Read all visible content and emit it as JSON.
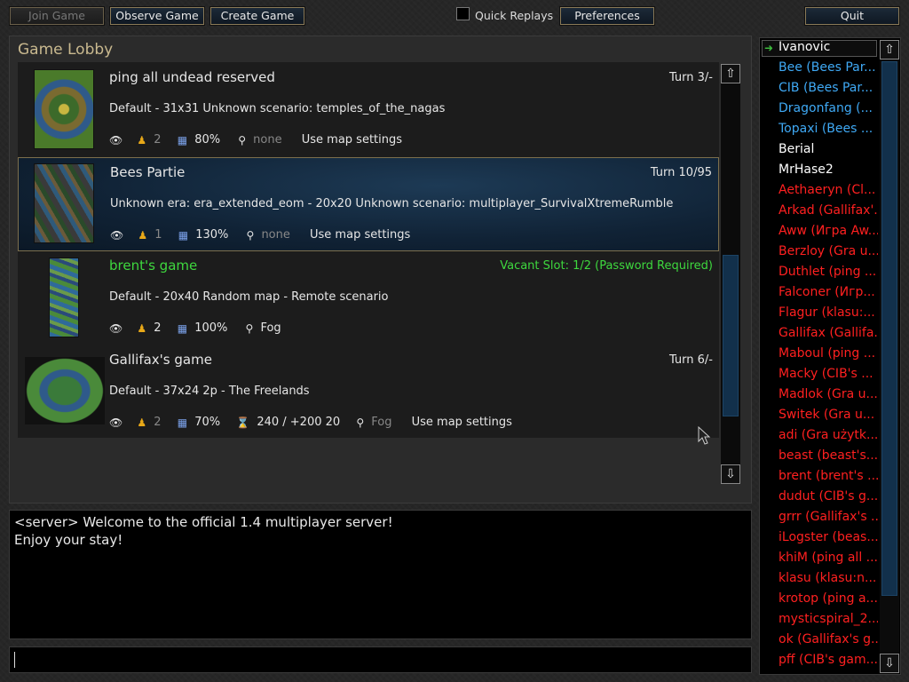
{
  "toolbar": {
    "join_game": "Join Game",
    "observe_game": "Observe Game",
    "create_game": "Create Game",
    "quick_replays": "Quick Replays",
    "preferences": "Preferences",
    "quit": "Quit"
  },
  "lobby": {
    "title": "Game Lobby",
    "games": [
      {
        "name": "ping all undead reserved",
        "status": "Turn 3/-",
        "description": "Default - 31x31 Unknown scenario: temples_of_the_nagas",
        "players": "2",
        "gold": "80%",
        "vision": "none",
        "settings": "Use map settings"
      },
      {
        "name": "Bees Partie",
        "status": "Turn 10/95",
        "description": "Unknown era: era_extended_eom - 20x20 Unknown scenario: multiplayer_SurvivalXtremeRumble",
        "players": "1",
        "gold": "130%",
        "vision": "none",
        "settings": "Use map settings"
      },
      {
        "name": "brent's game",
        "status": "Vacant Slot: 1/2 (Password Required)",
        "description": "Default - 20x40 Random map - Remote scenario",
        "players": "2",
        "gold": "100%",
        "vision": "Fog"
      },
      {
        "name": "Gallifax's game",
        "status": "Turn 6/-",
        "description": "Default - 37x24 2p - The Freelands",
        "players": "2",
        "gold": "70%",
        "timer": "240 / +200 20",
        "vision": "Fog",
        "settings": "Use map settings"
      }
    ]
  },
  "chat": {
    "lines": [
      "<server> Welcome to the official 1.4 multiplayer server!",
      "Enjoy your stay!"
    ],
    "input_value": ""
  },
  "users": [
    {
      "name": "Ivanovic",
      "color": "#ffffff"
    },
    {
      "name": "Bee (Bees Par...",
      "color": "#3fa9f5"
    },
    {
      "name": "CIB (Bees Par...",
      "color": "#3fa9f5"
    },
    {
      "name": "Dragonfang (...",
      "color": "#3fa9f5"
    },
    {
      "name": "Topaxi (Bees ...",
      "color": "#3fa9f5"
    },
    {
      "name": "Berial",
      "color": "#ffffff"
    },
    {
      "name": "MrHase2",
      "color": "#ffffff"
    },
    {
      "name": "Aethaeryn (Cl...",
      "color": "#ff2020"
    },
    {
      "name": "Arkad (Gallifax'...",
      "color": "#ff2020"
    },
    {
      "name": "Aww (Игра Aw...",
      "color": "#ff2020"
    },
    {
      "name": "Berzloy (Gra u...",
      "color": "#ff2020"
    },
    {
      "name": "Duthlet (ping ...",
      "color": "#ff2020"
    },
    {
      "name": "Falconer (Игр...",
      "color": "#ff2020"
    },
    {
      "name": "Flagur (klasu:...",
      "color": "#ff2020"
    },
    {
      "name": "Gallifax (Gallifa...",
      "color": "#ff2020"
    },
    {
      "name": "Maboul (ping ...",
      "color": "#ff2020"
    },
    {
      "name": "Macky (CIB's ...",
      "color": "#ff2020"
    },
    {
      "name": "Madlok (Gra u...",
      "color": "#ff2020"
    },
    {
      "name": "Switek (Gra u...",
      "color": "#ff2020"
    },
    {
      "name": "adi (Gra użytk...",
      "color": "#ff2020"
    },
    {
      "name": "beast (beast's...",
      "color": "#ff2020"
    },
    {
      "name": "brent (brent's ...",
      "color": "#ff2020"
    },
    {
      "name": "dudut (CIB's g...",
      "color": "#ff2020"
    },
    {
      "name": "grrr (Gallifax's ...",
      "color": "#ff2020"
    },
    {
      "name": "iLogster (beas...",
      "color": "#ff2020"
    },
    {
      "name": "khiM (ping all ...",
      "color": "#ff2020"
    },
    {
      "name": "klasu (klasu:n...",
      "color": "#ff2020"
    },
    {
      "name": "krotop (ping a...",
      "color": "#ff2020"
    },
    {
      "name": "mysticspiral_2...",
      "color": "#ff2020"
    },
    {
      "name": "ok (Gallifax's g...",
      "color": "#ff2020"
    },
    {
      "name": "pff (CIB's gam...",
      "color": "#ff2020"
    }
  ]
}
